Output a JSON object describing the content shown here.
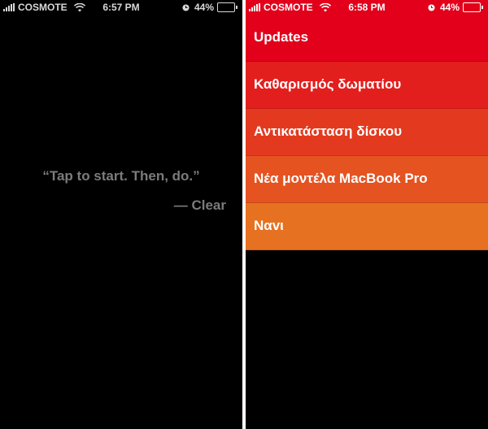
{
  "left": {
    "status": {
      "carrier": "COSMOTE",
      "time": "6:57 PM",
      "battery": "44%",
      "battery_level": 0.44
    },
    "quote": "“Tap to start. Then, do.”",
    "attribution": "— Clear"
  },
  "right": {
    "status": {
      "carrier": "COSMOTE",
      "time": "6:58 PM",
      "battery": "44%",
      "battery_level": 0.44
    },
    "items": [
      {
        "label": "Updates",
        "color": "#e2001b"
      },
      {
        "label": "Καθαρισμός δωματίου",
        "color": "#e31f1e"
      },
      {
        "label": "Αντικατάσταση δίσκου",
        "color": "#e33a1f"
      },
      {
        "label": "Νέα μοντέλα MacBook Pro",
        "color": "#e55321"
      },
      {
        "label": "Ναvι",
        "color": "#e67120"
      }
    ]
  }
}
